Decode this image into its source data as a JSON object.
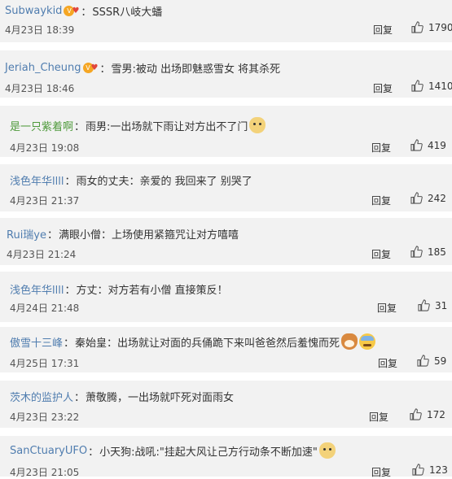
{
  "reply_label": "回复",
  "accent_color": "#507daf",
  "comments": [
    {
      "author": "Subwaykid",
      "vip": true,
      "text": "SSSR八岐大蟠",
      "date": "4月23日 18:39",
      "likes": "1790",
      "emoji": []
    },
    {
      "author": "Jeriah_Cheung",
      "vip": true,
      "text": "雪男:被动 出场即魅惑雪女 将其杀死",
      "date": "4月23日 18:46",
      "likes": "1410",
      "emoji": []
    },
    {
      "author": "是一只紫着啊",
      "vip": false,
      "text": "雨男:一出场就下雨让对方出不了门",
      "date": "4月23日 19:08",
      "likes": "419",
      "emoji": [
        "dog-emoji"
      ]
    },
    {
      "author": "浅色年华llll",
      "vip": false,
      "text": "雨女的丈夫：亲爱的 我回来了 别哭了",
      "date": "4月23日 21:37",
      "likes": "242",
      "emoji": []
    },
    {
      "author": "Rui瑞ye",
      "vip": false,
      "text": "满眼小僧：上场使用紧箍咒让对方嘻嘻",
      "date": "4月23日 21:24",
      "likes": "185",
      "emoji": []
    },
    {
      "author": "浅色年华llll",
      "vip": false,
      "text": "方丈：对方若有小僧 直接策反！",
      "date": "4月24日 21:48",
      "likes": "31",
      "emoji": []
    },
    {
      "author": "傲雪十三峰",
      "vip": false,
      "text": "秦始皇：出场就让对面的兵俑跪下来叫爸爸然后羞愧而死",
      "date": "4月25日 17:31",
      "likes": "59",
      "emoji": [
        "shiba-emoji",
        "sweat-emoji"
      ]
    },
    {
      "author": "茨木的监护人",
      "vip": false,
      "text": "萧敬腾，一出场就吓死对面雨女",
      "date": "4月23日 23:22",
      "likes": "172",
      "emoji": []
    },
    {
      "author": "SanCtuaryUFO",
      "vip": false,
      "text": "小天狗:战吼:\"挂起大风让己方行动条不断加速\"",
      "date": "4月23日 21:05",
      "likes": "123",
      "emoji": [
        "dog-emoji"
      ]
    }
  ]
}
